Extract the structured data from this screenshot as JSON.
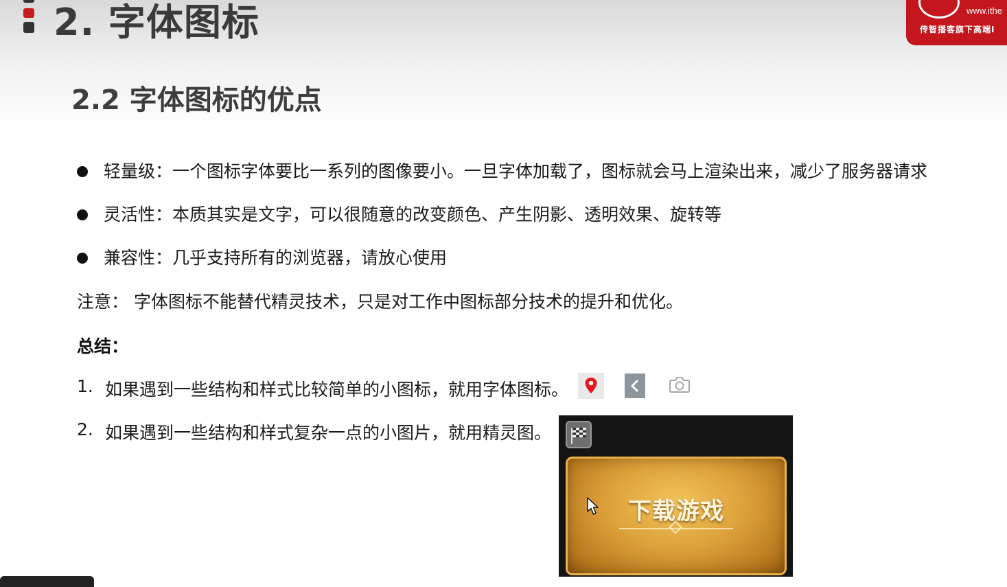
{
  "header": {
    "section_title": "2. 字体图标",
    "logo_url": "www.ithe",
    "logo_tagline": "传智播客旗下高端I"
  },
  "subtitle": "2.2 字体图标的优点",
  "bullets": [
    "轻量级：一个图标字体要比一系列的图像要小。一旦字体加载了，图标就会马上渲染出来，减少了服务器请求",
    "灵活性：本质其实是文字，可以很随意的改变颜色、产生阴影、透明效果、旋转等",
    "兼容性：几乎支持所有的浏览器，请放心使用"
  ],
  "note": "注意： 字体图标不能替代精灵技术，只是对工作中图标部分技术的提升和优化。",
  "summary": {
    "heading": "总结：",
    "items": [
      {
        "num": "1.",
        "text": "如果遇到一些结构和样式比较简单的小图标，就用字体图标。"
      },
      {
        "num": "2.",
        "text": "如果遇到一些结构和样式复杂一点的小图片，就用精灵图。"
      }
    ]
  },
  "example_icons": [
    "location-pin-icon",
    "back-arrow-icon",
    "camera-icon"
  ],
  "sprite_example": {
    "button_text": "下载游戏"
  },
  "colors": {
    "brand_red": "#c4161c",
    "pin_red": "#e8161c",
    "gold": "#dca03a"
  }
}
